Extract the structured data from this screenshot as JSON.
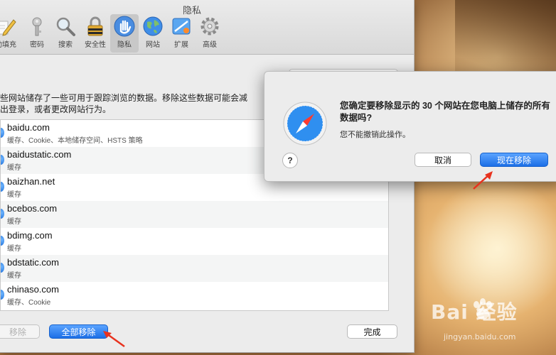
{
  "window": {
    "title": "隐私"
  },
  "toolbar": {
    "items": [
      {
        "label": "动填充",
        "icon": "pencil-icon"
      },
      {
        "label": "密码",
        "icon": "key-icon"
      },
      {
        "label": "搜索",
        "icon": "magnifier-icon"
      },
      {
        "label": "安全性",
        "icon": "lock-icon"
      },
      {
        "label": "隐私",
        "icon": "hand-icon"
      },
      {
        "label": "网站",
        "icon": "globe-icon"
      },
      {
        "label": "扩展",
        "icon": "puzzle-icon"
      },
      {
        "label": "高级",
        "icon": "gear-icon"
      }
    ],
    "selected": "隐私"
  },
  "description": {
    "line1": "些网站储存了一些可用于跟踪浏览的数据。移除这些数据可能会减",
    "line2": "出登录，或者更改网站行为。"
  },
  "sites": [
    {
      "name": "baidu.com",
      "detail": "缓存、Cookie、本地储存空间、HSTS 策略"
    },
    {
      "name": "baidustatic.com",
      "detail": "缓存"
    },
    {
      "name": "baizhan.net",
      "detail": "缓存"
    },
    {
      "name": "bcebos.com",
      "detail": "缓存"
    },
    {
      "name": "bdimg.com",
      "detail": "缓存"
    },
    {
      "name": "bdstatic.com",
      "detail": "缓存"
    },
    {
      "name": "chinaso.com",
      "detail": "缓存、Cookie"
    }
  ],
  "buttons": {
    "remove": "移除",
    "remove_all": "全部移除",
    "done": "完成"
  },
  "alert": {
    "title": "您确定要移除显示的 30 个网站在您电脑上储存的所有数据吗?",
    "subtitle": "您不能撤销此操作。",
    "help": "?",
    "cancel": "取消",
    "confirm": "现在移除"
  },
  "watermark": {
    "main": "Bai  经验",
    "sub": "jingyan.baidu.com"
  },
  "colors": {
    "accent": "#1c6fe6",
    "arrow": "#e8321e"
  }
}
